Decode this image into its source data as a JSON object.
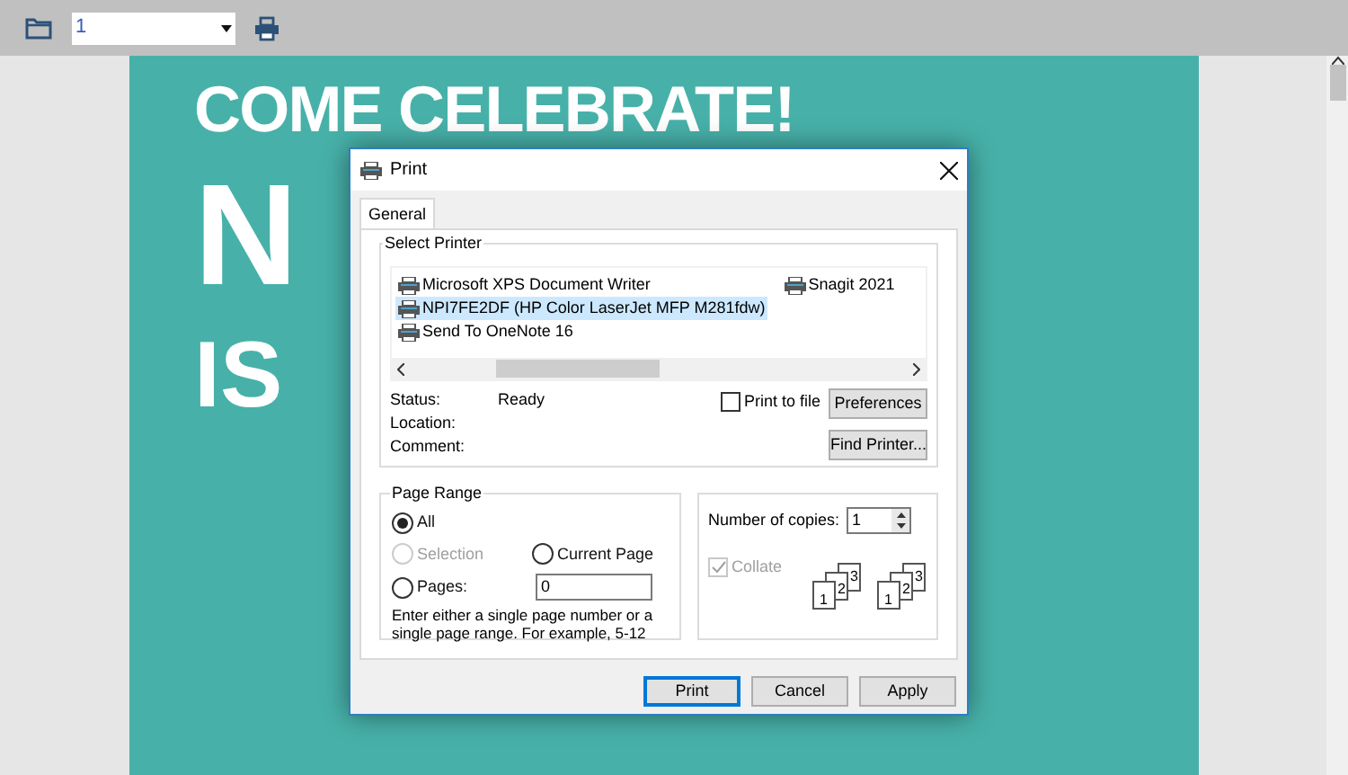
{
  "toolbar": {
    "page_select": {
      "value": "1"
    }
  },
  "poster": {
    "lines": [
      "COME CELEBRATE!",
      "N",
      "IS"
    ]
  },
  "dialog": {
    "title": "Print",
    "tabs": [
      {
        "label": "General",
        "selected": true
      }
    ],
    "select_printer": {
      "label": "Select Printer",
      "printers": [
        {
          "name": "Microsoft XPS Document Writer",
          "selected": false
        },
        {
          "name": "NPI7FE2DF (HP Color LaserJet MFP M281fdw)",
          "selected": true
        },
        {
          "name": "Send To OneNote 16",
          "selected": false
        },
        {
          "name": "Snagit 2021",
          "selected": false
        }
      ],
      "status_label": "Status:",
      "status": "Ready",
      "location_label": "Location:",
      "comment_label": "Comment:",
      "print_to_file": {
        "label": "Print to file",
        "checked": false
      },
      "preferences": "Preferences",
      "find_printer": "Find Printer..."
    },
    "page_range": {
      "label": "Page Range",
      "options": [
        {
          "label": "All",
          "selected": true,
          "disabled": false
        },
        {
          "label": "Selection",
          "selected": false,
          "disabled": true
        },
        {
          "label": "Current Page",
          "selected": false,
          "disabled": false
        },
        {
          "label": "Pages:",
          "selected": false,
          "disabled": false
        }
      ],
      "pages_value": "0",
      "hint": "Enter either a single page number or a single page range.  For example, 5-12"
    },
    "copies": {
      "label": "Number of copies:",
      "value": "1",
      "collate": {
        "label": "Collate",
        "checked": true,
        "disabled": true
      },
      "page_numbers": [
        "1",
        "2",
        "3",
        "1",
        "2",
        "3"
      ]
    },
    "buttons": [
      {
        "label": "Print",
        "default": true
      },
      {
        "label": "Cancel",
        "default": false
      },
      {
        "label": "Apply",
        "default": false
      }
    ]
  }
}
